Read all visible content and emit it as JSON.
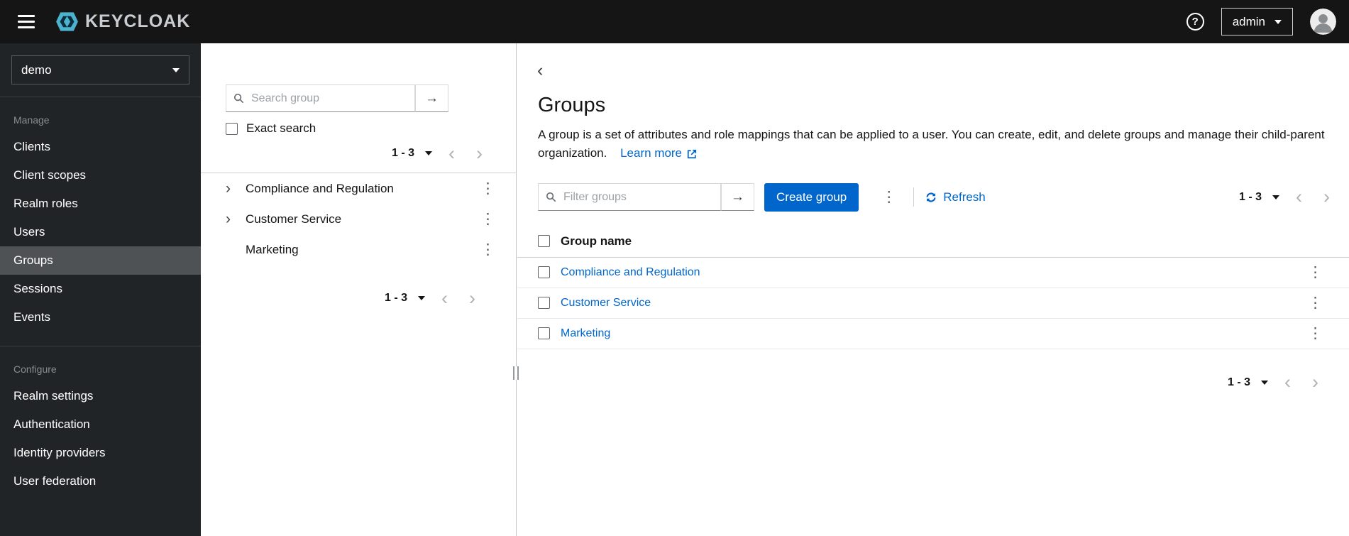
{
  "colors": {
    "accent": "#0066cc",
    "topbar_bg": "#151515",
    "sidebar_bg": "#212427",
    "sidebar_selected_bg": "#4f5255",
    "link": "#0066cc",
    "logo_cyan": "#4cb3cf"
  },
  "icons": {
    "help": "?",
    "arrow_right": "→",
    "kebab": "⋮",
    "chevron_left": "‹",
    "chevron_right": "›",
    "tree_expand": "›"
  },
  "topbar": {
    "brand": "KEYCLOAK",
    "user_menu": "admin"
  },
  "sidebar": {
    "realm_selector": "demo",
    "active_item": "Groups",
    "sections": [
      {
        "label": "Manage",
        "items": [
          {
            "label": "Clients"
          },
          {
            "label": "Client scopes"
          },
          {
            "label": "Realm roles"
          },
          {
            "label": "Users"
          },
          {
            "label": "Groups"
          },
          {
            "label": "Sessions"
          },
          {
            "label": "Events"
          }
        ]
      },
      {
        "label": "Configure",
        "items": [
          {
            "label": "Realm settings"
          },
          {
            "label": "Authentication"
          },
          {
            "label": "Identity providers"
          },
          {
            "label": "User federation"
          }
        ]
      }
    ]
  },
  "groups_panel": {
    "search_placeholder": "Search group",
    "exact_search_label": "Exact search",
    "pagination_range": "1 - 3",
    "tree_items": [
      {
        "label": "Compliance and Regulation",
        "expandable": true
      },
      {
        "label": "Customer Service",
        "expandable": true
      },
      {
        "label": "Marketing",
        "expandable": false
      }
    ]
  },
  "main": {
    "title": "Groups",
    "description": "A group is a set of attributes and role mappings that can be applied to a user. You can create, edit, and delete groups and manage their child-parent organization.",
    "learn_more_label": "Learn more",
    "toolbar": {
      "filter_placeholder": "Filter groups",
      "create_button_label": "Create group",
      "refresh_label": "Refresh",
      "pagination_range": "1 - 3"
    },
    "table": {
      "header": "Group name",
      "rows": [
        {
          "name": "Compliance and Regulation"
        },
        {
          "name": "Customer Service"
        },
        {
          "name": "Marketing"
        }
      ]
    },
    "bottom_pagination_range": "1 - 3"
  }
}
